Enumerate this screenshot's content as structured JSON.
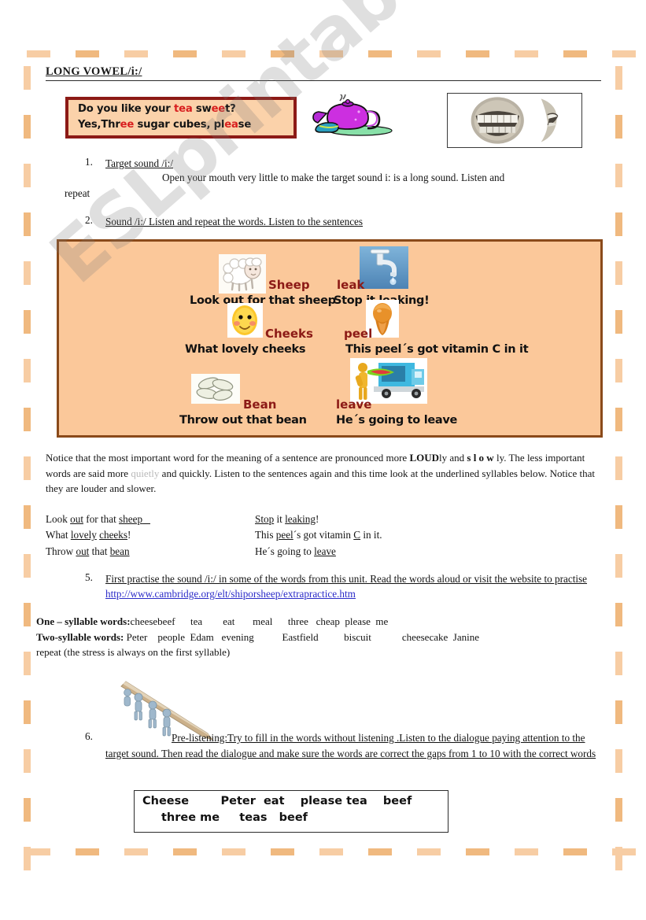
{
  "page": {
    "title": "LONG VOWEL/i:/",
    "watermark": "ESLprintables.com"
  },
  "dialogue": {
    "line1_a": "Do you like your ",
    "line1_tea": "tea",
    "line1_b": " sw",
    "line1_ee": "ee",
    "line1_c": "t?",
    "line2_a": "Yes,Thr",
    "line2_ee": "ee",
    "line2_b": " sugar cubes, pl",
    "line2_ea": "ea",
    "line2_c": "se"
  },
  "images": {
    "teapot": "teapot-clipart",
    "mouth": "mouth-teeth-photo",
    "sheep": "sheep-clipart",
    "tap": "dripping-tap-photo",
    "cheeks": "smiley-cheeks-icon",
    "peel": "orange-peel-photo",
    "bean": "beans-clipart",
    "truck": "removal-truck-photo",
    "pencil": "people-carrying-pencil-clipart"
  },
  "items": {
    "one": {
      "num": "1.",
      "heading": "Target sound /i:/",
      "body": "Open your mouth very little to make the target sound i: is a long sound. Listen and",
      "body2": "repeat"
    },
    "two": {
      "num": "2.",
      "heading": "Sound /i:/  Listen and repeat the words. Listen to the sentences"
    },
    "five": {
      "num": "5.",
      "text_before": "First practise the sound  /i:/  in some of the words from this unit. Read the words aloud or visit the website to practise ",
      "url": "http://www.cambridge.org/elt/shiporsheep/extrapractice.htm"
    },
    "six": {
      "num": "6.",
      "text": "Pre-listening:Try to fill in the words without listening .Listen to the dialogue paying attention to the target sound. Then read the dialogue and make sure the words are correct the gaps from 1 to 10 with the correct words"
    }
  },
  "word_panel": {
    "cells": [
      {
        "label": "Sheep",
        "sentence": "Look out for that sheep",
        "image": "sheep-clipart"
      },
      {
        "label": "leak",
        "sentence": "Stop it leaking!",
        "image": "dripping-tap-photo"
      },
      {
        "label": "Cheeks",
        "sentence": "What lovely cheeks",
        "image": "smiley-cheeks-icon"
      },
      {
        "label": "peel",
        "sentence": "This peel´s got vitamin C in it",
        "image": "orange-peel-photo"
      },
      {
        "label": "Bean",
        "sentence": "Throw out that bean",
        "image": "beans-clipart"
      },
      {
        "label": "leave",
        "sentence": "He´s going to leave",
        "image": "removal-truck-photo"
      }
    ]
  },
  "notice": {
    "p1": "Notice that the most important word for the meaning of a sentence are pronounced more ",
    "loud": "LOUD",
    "p2": "ly and ",
    "slow": "s l o w",
    "p3": " ly. The less important words are said more ",
    "quietly": "quietly",
    "p4": " and quickly. Listen to the sentences again and this time look at the underlined syllables below. Notice that they are louder and slower."
  },
  "stress_sentences": {
    "left": [
      {
        "pre": "Look ",
        "u1": "out",
        "mid": " for that ",
        "u2": "sheep",
        "post": ""
      },
      {
        "pre": "What ",
        "u1": "lovely",
        "mid": " ",
        "u2": "cheeks",
        "post": "!"
      },
      {
        "pre": "Throw ",
        "u1": "out",
        "mid": " that ",
        "u2": "bean",
        "post": ""
      }
    ],
    "right": [
      {
        "pre": "",
        "u1": "Stop",
        "mid": " it ",
        "u2": "leaking",
        "post": "!"
      },
      {
        "pre": "This ",
        "u1": "peel",
        "mid": "´s got vitamin ",
        "u2": "C",
        "post": " in it."
      },
      {
        "pre": "He´s going to ",
        "u1": "leave",
        "mid": "",
        "u2": "",
        "post": ""
      }
    ]
  },
  "syllables": {
    "one_label": "One – syllable words:",
    "one_words": "cheesebeef      tea        eat       meal      three   cheap  please  me",
    "two_label": "Two-syllable words:",
    "two_words": " Peter    people  Edam   evening           Eastfield          biscuit            cheesecake  Janine",
    "note": "repeat   (the stress is always on the first syllable)"
  },
  "word_bank": {
    "line1": "Cheese        Peter  eat    please tea    beef",
    "line2": "three me     teas   beef"
  }
}
